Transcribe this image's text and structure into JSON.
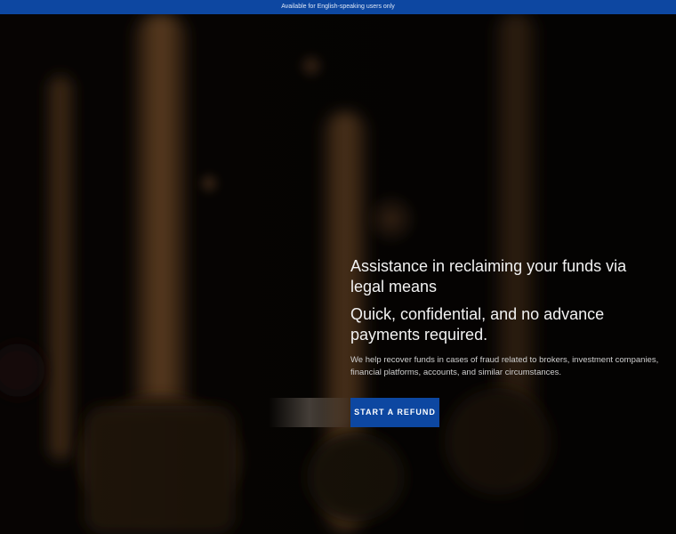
{
  "banner": {
    "text": "Available for English-speaking users only"
  },
  "hero": {
    "headline": "Assistance in reclaiming your funds via legal means",
    "subheadline": "Quick, confidential, and no advance payments required.",
    "description": "We help recover funds in cases of fraud related to brokers, investment companies, financial platforms, accounts, and similar circumstances.",
    "cta_label": "START A REFUND"
  },
  "colors": {
    "banner_bg": "#0d47a1",
    "button_bg": "#0d47a1",
    "page_bg": "#0a0705"
  }
}
